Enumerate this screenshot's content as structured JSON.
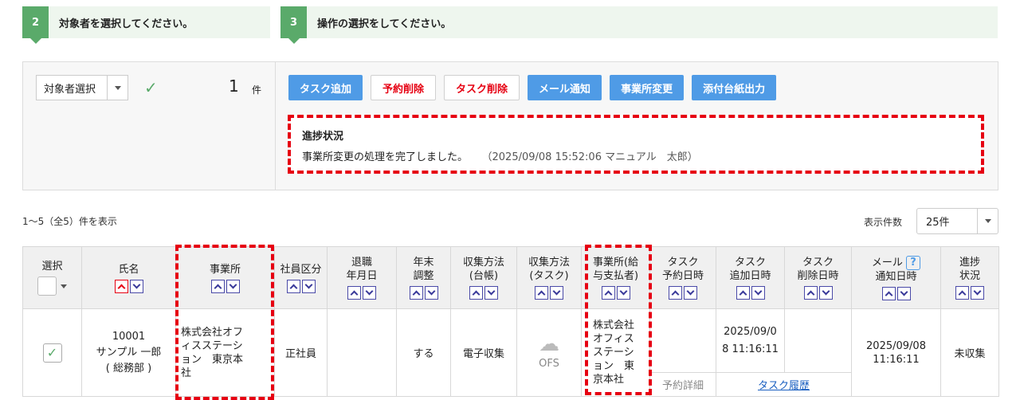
{
  "steps": [
    {
      "num": "2",
      "label": "対象者を選択してください。"
    },
    {
      "num": "3",
      "label": "操作の選択をしてください。"
    }
  ],
  "target": {
    "select_label": "対象者選択",
    "count": "1",
    "count_unit": "件"
  },
  "actions": {
    "add_task": "タスク追加",
    "delete_reservation": "予約削除",
    "delete_task": "タスク削除",
    "mail_notify": "メール通知",
    "change_office": "事業所変更",
    "print_cover": "添付台紙出力"
  },
  "progress": {
    "title": "進捗状況",
    "message": "事業所変更の処理を完了しました。",
    "meta": "（2025/09/08 15:52:06 マニュアル　太郎）"
  },
  "list": {
    "range": "1〜5（全5）件を表示",
    "per_page_label": "表示件数",
    "per_page_value": "25件"
  },
  "table": {
    "headers": {
      "select": "選択",
      "name": "氏名",
      "office": "事業所",
      "emp_type": "社員区分",
      "retire_l1": "退職",
      "retire_l2": "年月日",
      "yearend_l1": "年末",
      "yearend_l2": "調整",
      "collect_ledger_l1": "収集方法",
      "collect_ledger_l2": "(台帳)",
      "collect_task_l1": "収集方法",
      "collect_task_l2": "(タスク)",
      "payer_office_l1": "事業所(給",
      "payer_office_l2": "与支払者)",
      "task_reserve_l1": "タスク",
      "task_reserve_l2": "予約日時",
      "task_add_l1": "タスク",
      "task_add_l2": "追加日時",
      "task_del_l1": "タスク",
      "task_del_l2": "削除日時",
      "mail_l1": "メール",
      "mail_l2": "通知日時",
      "progress_l1": "進捗",
      "progress_l2": "状況"
    },
    "row": {
      "emp_id": "10001",
      "name": "サンプル 一郎",
      "dept": "( 総務部 )",
      "office_l1": "株式会社オフ",
      "office_l2": "ィスステーシ",
      "office_l3": "ョン　東京本",
      "office_l4": "社",
      "emp_type": "正社員",
      "retire": "",
      "yearend": "する",
      "collect_ledger": "電子収集",
      "collect_task": "OFS",
      "payer_l1": "株式会社",
      "payer_l2": "オフィス",
      "payer_l3": "ステーシ",
      "payer_l4": "ョン　東",
      "payer_l5": "京本社",
      "task_add_l1": "2025/09/0",
      "task_add_l2": "8 11:16:11",
      "mail_l1": "2025/09/08",
      "mail_l2": "11:16:11",
      "status": "未収集",
      "reserve_detail": "予約詳細",
      "task_history": "タスク履歴"
    }
  },
  "colors": {
    "accent_green": "#5aaa6a",
    "button_blue": "#4f9be6",
    "danger_red": "#e60012"
  }
}
